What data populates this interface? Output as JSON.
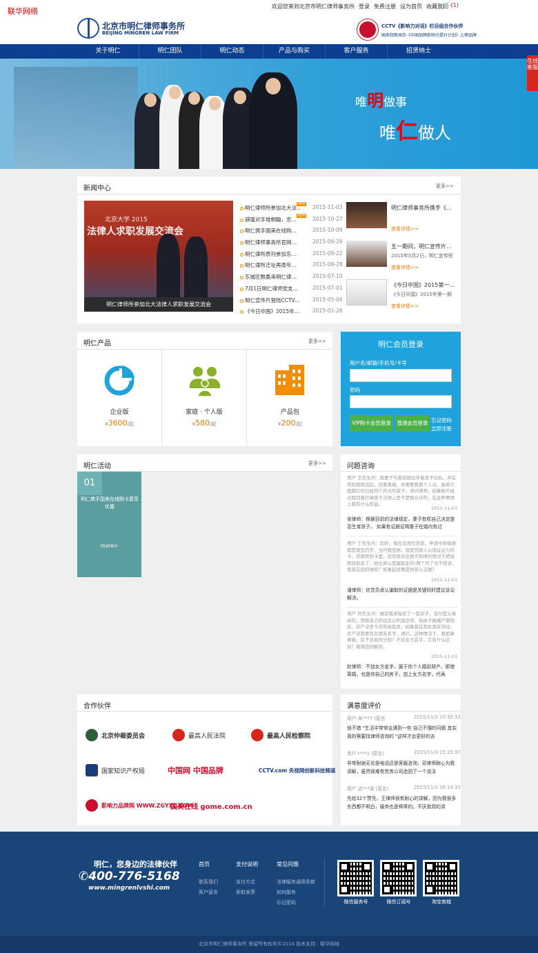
{
  "site_badge": "联华网络",
  "topbar": {
    "welcome": "欢迎您来到北京市明仁律师事务所",
    "login": "登录",
    "register": "免费注册",
    "set_home": "设为首页",
    "bookmark": "收藏我们",
    "cart_count": "(1)"
  },
  "header": {
    "logo_cn": "北京市明仁律师事务所",
    "logo_en": "BEIJING MINGREN LAW FIRM",
    "cctv_line1": "CCTV《影响力对话》栏目组合作伙伴",
    "cctv_line2": "国务院新闻办《中国品牌影响力提升计划》上榜品牌"
  },
  "nav": [
    "关于明仁",
    "明仁团队",
    "明仁动态",
    "产品与购买",
    "客户服务",
    "招贤纳士"
  ],
  "banner": {
    "slogan1_a": "唯",
    "slogan1_b": "明",
    "slogan1_c": "做事",
    "slogan2_a": "唯",
    "slogan2_b": "仁",
    "slogan2_c": "做人",
    "side_tab": "在线客服"
  },
  "news": {
    "title": "新闻中心",
    "more": "更多>>",
    "image_caption": "明仁律师所参加北大法律人求职发展交流会",
    "image_banner_text": "北京大学 2015",
    "image_banner_text2": "法律人求职发展交流会",
    "items": [
      {
        "title": "明仁律师所参加北大法…",
        "date": "2015-11-03",
        "new": true
      },
      {
        "title": "骐瑗对手堆桐翰，忠…",
        "date": "2015-10-27",
        "new": true
      },
      {
        "title": "明仁携手国美在线购…",
        "date": "2015-10-09",
        "new": false
      },
      {
        "title": "明仁律师事务所官网…",
        "date": "2015-09-29",
        "new": false
      },
      {
        "title": "明仁律所质刊参加东…",
        "date": "2015-09-22",
        "new": false
      },
      {
        "title": "明仁律所迁址再周年…",
        "date": "2015-08-28",
        "new": false
      },
      {
        "title": "东城区数委来明仁律…",
        "date": "2015-07-10",
        "new": false
      },
      {
        "title": "7月1日明仁律师党支…",
        "date": "2015-07-01",
        "new": false
      },
      {
        "title": "明仁宣传片登陆CCTV…",
        "date": "2015-05-04",
        "new": false
      },
      {
        "title": "《今日中国》2015年…",
        "date": "2015-01-26",
        "new": false
      }
    ],
    "videos": [
      {
        "title": "明仁律师事务所携手《…",
        "sub": "",
        "more": "查看详情>>"
      },
      {
        "title": "五一期间，明仁宣传片…",
        "sub": "2015年5月2日，明仁宣传短",
        "more": "查看详情>>"
      },
      {
        "title": "《今日中国》2015第一…",
        "sub": "《今日中国》2015年第一期",
        "more": "查看详情>>"
      }
    ]
  },
  "products": {
    "title": "明仁产品",
    "more": "更多>>",
    "items": [
      {
        "name": "企业版",
        "currency": "¥",
        "price": "3600",
        "unit": "/起",
        "color": "#1ea3dd"
      },
      {
        "name": "家庭 · 个人版",
        "currency": "¥",
        "price": "580",
        "unit": "/起",
        "color": "#8bb02b"
      },
      {
        "name": "产品包",
        "currency": "¥",
        "price": "200",
        "unit": "/起",
        "color": "#f28c00"
      }
    ]
  },
  "login": {
    "title": "明仁会员登录",
    "user_label": "用户名/邮箱/手机号/卡号",
    "pass_label": "密码",
    "vip_button": "VIP购卡会员登录",
    "normal_button": "普通会员登录",
    "forgot": "忘记密码",
    "register": "立即注册"
  },
  "activities": {
    "title": "明仁活动",
    "more": "更多>>",
    "card_num": "01",
    "card_title": "明仁携手国美在线购卡尊享优惠",
    "card_more": "more>"
  },
  "qa": {
    "title": "问题咨询",
    "items": [
      {
        "q": "用户 王先生问：我妻子与我结婚后怀着孩子出轨，并在得到我原谅后，还要离婚，并要要看那个人过，独单方面都打妈已经四个月大的孩子，请问律师，如果她不经过我同意打掉孩子法律上是不是够允许的，在这种事情上我有什么权益。",
        "date": "2015-11-03",
        "a": "张律师：根据目前的法律规定，妻子有权自己决定是否生育孩子。 如果有证据证明妻子在婚内有过"
      },
      {
        "q": "用户 丁先生问：您好，我在信用社贷款，申请书和借据都是我签的字，当时我签据，但是贷款人从保证出力的卡，贷款转到卡里，但贷款员在我不知情的情况下把钱转自取走了，他出来认是骗取走的!两个月了也不知该，我现在如何维权？如果起诉要提供甚么证据？",
        "date": "2015-11-03",
        "a": "潘律师：信贷员承认骗取的证据是关键同时建议诉讼解决。"
      },
      {
        "q": "用户 刘先生问：婚前我单独买了一套房子，首付是父母给的，用我自己的住房公积金还贷。现由于搬播产需购房，房产证至今没有给我发，如果我在和女朋友领证，房产证就要有女朋友名字。请问，这种情况下，我如果离婚，房子该如何分割？不加女方名字，又有什么区别？谢谢您的解答。",
        "date": "2015-11-03",
        "a": "赵律师：不加女方名字，属于你个人婚前财产，即使离婚，也是你自己的房子，加上女方名字，代表"
      }
    ]
  },
  "partners": {
    "title": "合作伙伴",
    "items": [
      {
        "name": "北京仲裁委员会",
        "color": "#1a1a1a"
      },
      {
        "name": "最高人民法院",
        "color": "#1a1a1a"
      },
      {
        "name": "最高人民检察院",
        "color": "#1a1a1a"
      },
      {
        "name": "国家知识产权局",
        "color": "#1a3d7a"
      },
      {
        "name": "中国网 中国品牌",
        "color": "#c8102e"
      },
      {
        "name": "CCTV.com 央视网创新科技频道",
        "color": "#1a3d7a"
      },
      {
        "name": "影响力品牌网 WWW.ZGYXL.COM",
        "color": "#c8102e"
      },
      {
        "name": "国美在线 gome.com.cn",
        "color": "#c8102e"
      }
    ]
  },
  "reviews": {
    "title": "满意度评价",
    "items": [
      {
        "user": "用户 朱***7 (匿名",
        "date": "2015/11/3 10:30:33",
        "text": "很不错 \"生活中常常会遇到一些 自己不懂的问题 其实 真的需要找律师咨询的 \"这样才会更好的去"
      },
      {
        "user": "用户 t***1 (匿名)",
        "date": "2015/11/3 15:15:37",
        "text": "非常耐谢无论是电话还是客服咨询，邓律师耐心为我讲解，虽然很难有劳务公司追回了一个说法"
      },
      {
        "user": "用户 这***迷 (匿名)",
        "date": "2015/11/3 16:14:33",
        "text": "先给32个赞先，王律师很有耐心的讲解，因为我很多东西都不明白，服务也是棒棒的。不厌其烦的讲"
      }
    ]
  },
  "footer": {
    "slogan": "明仁，您身边的法律伙伴",
    "phone": "400-776-5168",
    "url": "www.mingrenlvshi.com",
    "cols": [
      {
        "title": "首页",
        "links": [
          "联系我们",
          "客户留言"
        ]
      },
      {
        "title": "支付说明",
        "links": [
          "支付方式",
          "索取发票"
        ]
      },
      {
        "title": "常见问题",
        "links": [
          "法律服务通用条款",
          "如何服务",
          "忘记密码"
        ]
      }
    ],
    "qr": [
      "微信服务号",
      "微信订阅号",
      "淘宝商城"
    ],
    "copyright": "北京市明仁律师事务所 保留所有权利©2014 技术支持：联华网络"
  }
}
